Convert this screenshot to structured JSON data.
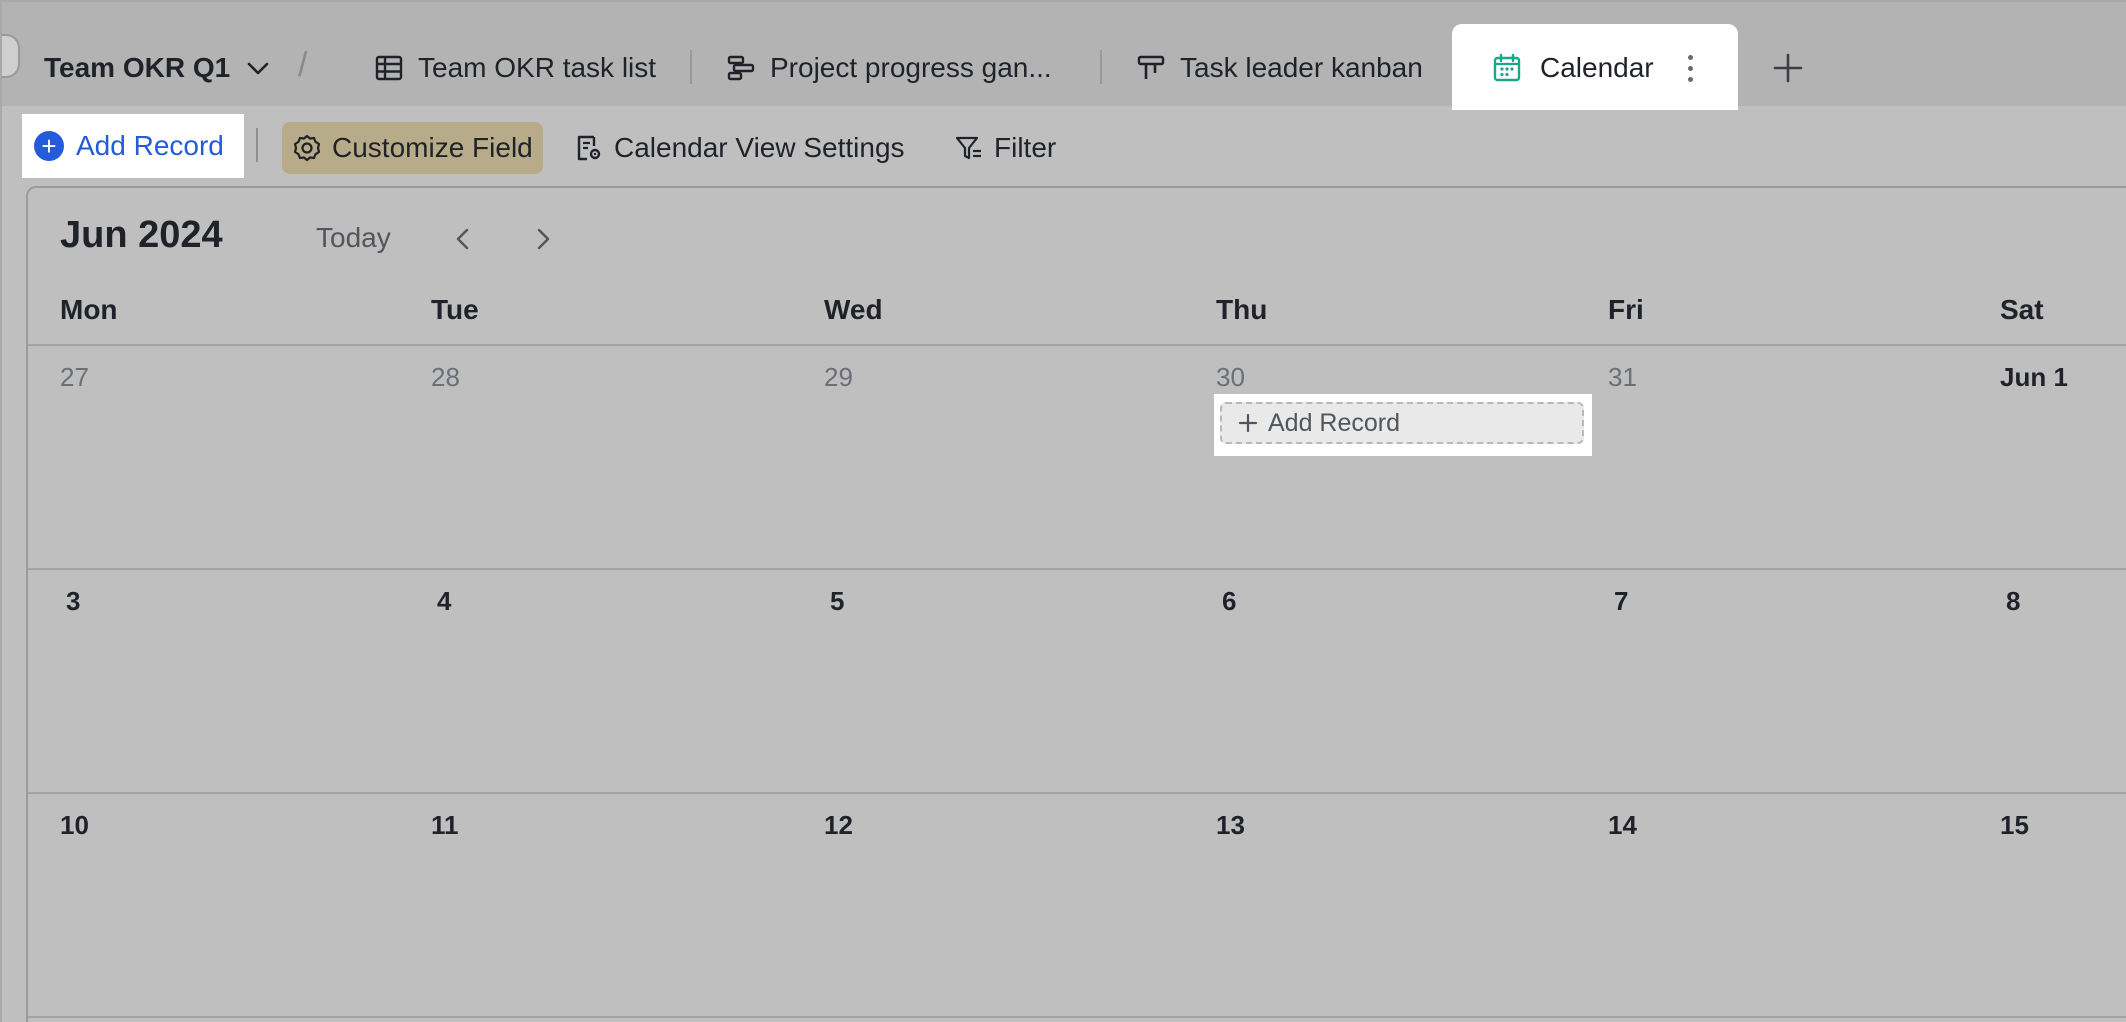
{
  "tabbar": {
    "base_name": "Team OKR Q1",
    "separator": "/",
    "tabs": [
      {
        "label": "Team OKR task list",
        "icon": "grid-table-icon"
      },
      {
        "label": "Project progress gan...",
        "icon": "gantt-icon"
      },
      {
        "label": "Task leader kanban",
        "icon": "kanban-icon"
      }
    ],
    "active_tab": {
      "label": "Calendar",
      "icon": "calendar-icon",
      "accent": "#1aa88a"
    }
  },
  "toolbar": {
    "add_record": "Add Record",
    "customize_field": "Customize Field",
    "calendar_settings": "Calendar View Settings",
    "filter": "Filter",
    "accent": "#245bdb"
  },
  "calendar": {
    "month_label": "Jun 2024",
    "today_label": "Today",
    "weekdays": [
      "Mon",
      "Tue",
      "Wed",
      "Thu",
      "Fri",
      "Sat"
    ],
    "weeks": [
      [
        {
          "d": "27",
          "cur": false
        },
        {
          "d": "28",
          "cur": false
        },
        {
          "d": "29",
          "cur": false
        },
        {
          "d": "30",
          "cur": false
        },
        {
          "d": "31",
          "cur": false
        },
        {
          "d": "Jun 1",
          "cur": true
        }
      ],
      [
        {
          "d": "3",
          "cur": true
        },
        {
          "d": "4",
          "cur": true
        },
        {
          "d": "5",
          "cur": true
        },
        {
          "d": "6",
          "cur": true
        },
        {
          "d": "7",
          "cur": true
        },
        {
          "d": "8",
          "cur": true
        }
      ],
      [
        {
          "d": "10",
          "cur": true
        },
        {
          "d": "11",
          "cur": true
        },
        {
          "d": "12",
          "cur": true
        },
        {
          "d": "13",
          "cur": true
        },
        {
          "d": "14",
          "cur": true
        },
        {
          "d": "15",
          "cur": true
        }
      ]
    ],
    "cell_add_record": "Add Record"
  }
}
